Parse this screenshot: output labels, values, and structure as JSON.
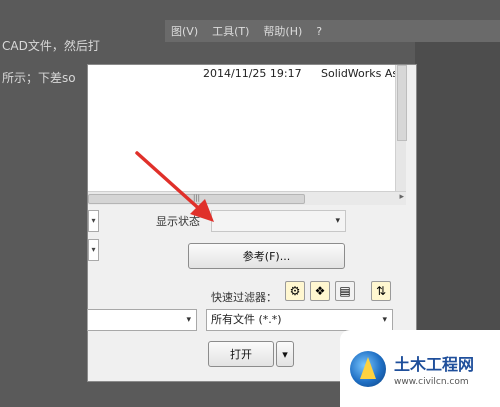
{
  "background": {
    "left_lines": [
      "CAD文件，然后打",
      "所示；下差so"
    ],
    "menubar": [
      "图(V)",
      "工具(T)",
      "帮助(H)",
      "?"
    ]
  },
  "dialog": {
    "list": {
      "rows": [
        {
          "date": "2014/11/25 19:17",
          "type": "SolidWorks Ass"
        }
      ],
      "hscroll_grip": "|||"
    },
    "display_state_label": "显示状态",
    "display_state_value": "",
    "reference_button": "参考(F)...",
    "quick_filter_label": "快速过滤器：",
    "file_type_value": "所有文件 (*.*)",
    "open_button": "打开",
    "open_dropdown_arrow": "▾"
  },
  "watermark": {
    "title": "土木工程网",
    "url": "www.civilcn.com"
  },
  "colors": {
    "annotation_arrow": "#e0302a",
    "watermark_blue": "#1f4f9b"
  }
}
